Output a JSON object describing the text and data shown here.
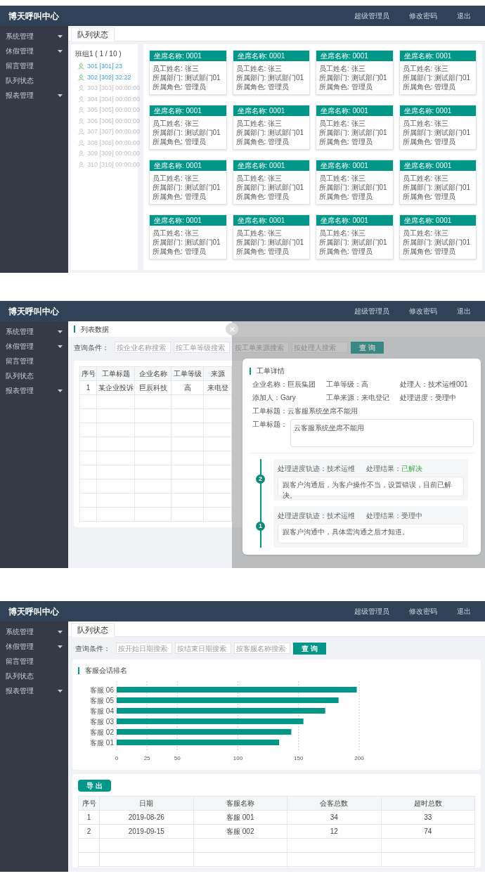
{
  "screens": [
    {
      "kind": "queue_status",
      "header": {
        "title": "博天呼叫中心",
        "links": [
          "超级管理员",
          "修改密码",
          "退出"
        ]
      },
      "sidebar": {
        "items": [
          {
            "label": "系统管理",
            "expandable": true
          },
          {
            "label": "休假管理",
            "expandable": true
          },
          {
            "label": "留言管理",
            "expandable": false
          },
          {
            "label": "队列状态",
            "expandable": false
          },
          {
            "label": "报表管理",
            "expandable": true
          }
        ]
      },
      "tabs": [
        {
          "label": "队列状态",
          "selected": true
        }
      ],
      "group": {
        "title": "班组1 ( 1 / 10 )",
        "members": [
          {
            "label": "301 [301] 23",
            "online": true
          },
          {
            "label": "302 [302] 32:22",
            "online": true
          },
          {
            "label": "303 [303] 00:00:00",
            "online": false
          },
          {
            "label": "304 [304] 00:00:00",
            "online": false
          },
          {
            "label": "305 [305] 00:00:00",
            "online": false
          },
          {
            "label": "306 [306] 00:00:00",
            "online": false
          },
          {
            "label": "307 [307] 00:00:00",
            "online": false
          },
          {
            "label": "308 [308] 00:00:00",
            "online": false
          },
          {
            "label": "309 [309] 00:00:00",
            "online": false
          },
          {
            "label": "310 [310] 00:00:00",
            "online": false
          }
        ]
      },
      "seats": [
        {
          "title": "坐席名称: 0001",
          "lines": [
            "员工姓名: 张三",
            "所属部门: 测试部门01",
            "所属角色: 管理员"
          ]
        },
        {
          "title": "坐席名称: 0001",
          "lines": [
            "员工姓名: 张三",
            "所属部门: 测试部门01",
            "所属角色: 管理员"
          ]
        },
        {
          "title": "坐席名称: 0001",
          "lines": [
            "员工姓名: 张三",
            "所属部门: 测试部门01",
            "所属角色: 管理员"
          ]
        },
        {
          "title": "坐席名称: 0001",
          "lines": [
            "员工姓名: 张三",
            "所属部门: 测试部门01",
            "所属角色: 管理员"
          ]
        },
        {
          "title": "坐席名称: 0001",
          "lines": [
            "员工姓名: 张三",
            "所属部门: 测试部门01",
            "所属角色: 管理员"
          ]
        },
        {
          "title": "坐席名称: 0001",
          "lines": [
            "员工姓名: 张三",
            "所属部门: 测试部门01",
            "所属角色: 管理员"
          ]
        },
        {
          "title": "坐席名称: 0001",
          "lines": [
            "员工姓名: 张三",
            "所属部门: 测试部门01",
            "所属角色: 管理员"
          ]
        },
        {
          "title": "坐席名称: 0001",
          "lines": [
            "员工姓名: 张三",
            "所属部门: 测试部门01",
            "所属角色: 管理员"
          ]
        },
        {
          "title": "坐席名称: 0001",
          "lines": [
            "员工姓名: 张三",
            "所属部门: 测试部门01",
            "所属角色: 管理员"
          ]
        },
        {
          "title": "坐席名称: 0001",
          "lines": [
            "员工姓名: 张三",
            "所属部门: 测试部门01",
            "所属角色: 管理员"
          ]
        },
        {
          "title": "坐席名称: 0001",
          "lines": [
            "员工姓名: 张三",
            "所属部门: 测试部门01",
            "所属角色: 管理员"
          ]
        },
        {
          "title": "坐席名称: 0001",
          "lines": [
            "员工姓名: 张三",
            "所属部门: 测试部门01",
            "所属角色: 管理员"
          ]
        },
        {
          "title": "坐席名称: 0001",
          "lines": [
            "员工姓名: 张三",
            "所属部门: 测试部门01",
            "所属角色: 管理员"
          ]
        },
        {
          "title": "坐席名称: 0001",
          "lines": [
            "员工姓名: 张三",
            "所属部门: 测试部门01",
            "所属角色: 管理员"
          ]
        },
        {
          "title": "坐席名称: 0001",
          "lines": [
            "员工姓名: 张三",
            "所属部门: 测试部门01",
            "所属角色: 管理员"
          ]
        },
        {
          "title": "坐席名称: 0001",
          "lines": [
            "员工姓名: 张三",
            "所属部门: 测试部门01",
            "所属角色: 管理员"
          ]
        }
      ]
    },
    {
      "kind": "ticket_detail",
      "header": {
        "title": "博天呼叫中心",
        "links": [
          "超级管理员",
          "修改密码",
          "退出"
        ]
      },
      "sidebar": {
        "items": [
          {
            "label": "系统管理",
            "expandable": true
          },
          {
            "label": "休假管理",
            "expandable": true
          },
          {
            "label": "留言管理",
            "expandable": false
          },
          {
            "label": "队列状态",
            "expandable": false
          },
          {
            "label": "报表管理",
            "expandable": true
          }
        ]
      },
      "section_title": "列表数据",
      "query": {
        "label": "查询条件：",
        "fields": [
          {
            "placeholder": "按企业名称搜索"
          },
          {
            "placeholder": "按工单等级搜索"
          },
          {
            "placeholder": "按工单来源搜索"
          },
          {
            "placeholder": "按处理人搜索"
          }
        ],
        "button": "查 询"
      },
      "table": {
        "columns": [
          "序号",
          "工单标题",
          "企业名称",
          "工单等级",
          "来源"
        ],
        "rows": [
          [
            "1",
            "某企业投诉",
            "巨辰科技",
            "高",
            "来电登"
          ]
        ]
      },
      "detail": {
        "title": "工单详情",
        "fields": [
          "企业名称：巨辰集团",
          "工单等级：高",
          "处理人：技术运维001",
          "添加人：Gary",
          "工单来源：来电登记",
          "处理进度：受理中"
        ],
        "subject": "工单标题：云客服系统坐席不能用",
        "content_label": "工单标题：",
        "content": "云客服系统坐席不能用",
        "timeline": [
          {
            "step": "2",
            "track": "处理进度轨迹：技术运维",
            "result_label": "处理结果：",
            "result": "已解决",
            "resolved": true,
            "note": "跟客户沟通后，为客户操作不当，设置错误，目前已解决。"
          },
          {
            "step": "1",
            "track": "处理进度轨迹：技术运维",
            "result_label": "处理结果：",
            "result": "受理中",
            "resolved": false,
            "note": "跟客户沟通中，具体需沟通之后才知道。"
          }
        ]
      }
    },
    {
      "kind": "report",
      "header": {
        "title": "博天呼叫中心",
        "links": [
          "超级管理员",
          "修改密码",
          "退出"
        ]
      },
      "sidebar": {
        "items": [
          {
            "label": "系统管理",
            "expandable": true
          },
          {
            "label": "休假管理",
            "expandable": true
          },
          {
            "label": "留言管理",
            "expandable": false
          },
          {
            "label": "队列状态",
            "expandable": false
          },
          {
            "label": "报表管理",
            "expandable": true
          }
        ]
      },
      "tabs": [
        {
          "label": "队列状态",
          "selected": true
        }
      ],
      "query": {
        "label": "查询条件：",
        "fields": [
          {
            "placeholder": "按开始日期搜索"
          },
          {
            "placeholder": "按结束日期搜索"
          },
          {
            "placeholder": "按客服名称搜索"
          }
        ],
        "button": "查 询"
      },
      "chart": {
        "title": "客服会话排名",
        "chart_data": {
          "type": "bar",
          "orientation": "horizontal",
          "categories": [
            "客服 06",
            "客服 05",
            "客服 04",
            "客服 03",
            "客服 02",
            "客服 01"
          ],
          "values": [
            198,
            183,
            172,
            154,
            144,
            134
          ],
          "xlim": [
            0,
            200
          ],
          "xticks": [
            0,
            25,
            50,
            100,
            150,
            200
          ],
          "grid": true
        }
      },
      "export_button": "导 出",
      "table": {
        "columns": [
          "序号",
          "日期",
          "客服名称",
          "会客总数",
          "超时总数"
        ],
        "rows": [
          [
            "1",
            "2019-08-26",
            "客服 001",
            "34",
            "33"
          ],
          [
            "2",
            "2019-09-15",
            "客服 002",
            "12",
            "74"
          ]
        ]
      }
    }
  ]
}
